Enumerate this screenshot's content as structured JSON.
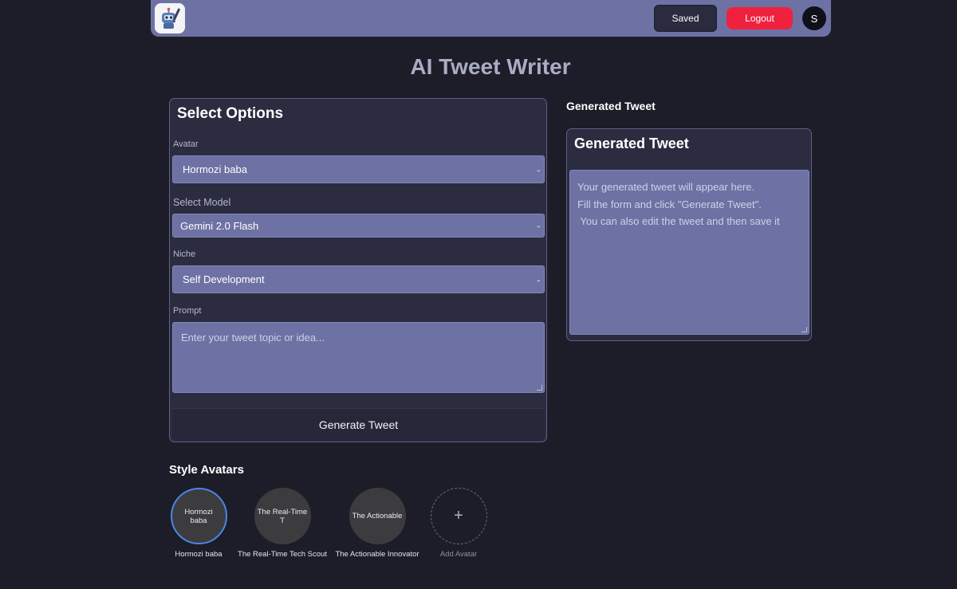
{
  "navbar": {
    "saved_label": "Saved",
    "logout_label": "Logout",
    "user_initial": "S",
    "logo_icon": "robot-writer-logo-icon"
  },
  "page": {
    "title": "AI Tweet Writer"
  },
  "options": {
    "title": "Select Options",
    "avatar_label": "Avatar",
    "avatar_value": "Hormozi baba",
    "model_label": "Select Model",
    "model_value": "Gemini 2.0 Flash",
    "niche_label": "Niche",
    "niche_value": "Self Development",
    "prompt_label": "Prompt",
    "prompt_placeholder": "Enter your tweet topic or idea...",
    "generate_label": "Generate Tweet"
  },
  "generated": {
    "heading": "Generated Tweet",
    "card_title": "Generated Tweet",
    "placeholder_lines": [
      "Your generated tweet will appear here.",
      "Fill the form and click \"Generate Tweet\".",
      " You can also edit the tweet and then save it"
    ]
  },
  "style_avatars": {
    "heading": "Style Avatars",
    "items": [
      {
        "circle_text": "Hormozi baba",
        "label": "Hormozi baba",
        "active": true
      },
      {
        "circle_text": "The Real-Time T",
        "label": "The Real-Time Tech Scout",
        "active": false
      },
      {
        "circle_text": "The Actionable",
        "label": "The Actionable Innovator",
        "active": false
      }
    ],
    "add": {
      "symbol": "+",
      "label": "Add Avatar"
    }
  },
  "colors": {
    "background": "#1c1d28",
    "navbar": "#6e71a3",
    "card": "#2b2c40",
    "input": "#6e71a3",
    "logout": "#f0213e",
    "active_ring": "#4a86e8"
  }
}
